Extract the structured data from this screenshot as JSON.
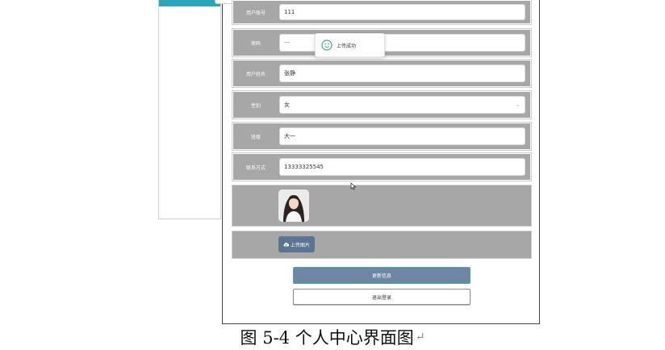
{
  "form": {
    "fields": [
      {
        "label": "用户账号",
        "value": "111"
      },
      {
        "label": "密码",
        "value": "···"
      },
      {
        "label": "用户姓名",
        "value": "张静"
      },
      {
        "label": "性别",
        "value": "女"
      },
      {
        "label": "班级",
        "value": "大一"
      },
      {
        "label": "联系方式",
        "value": "13333325545"
      }
    ],
    "upload_label": "上传图片",
    "update_label": "更新信息",
    "logout_label": "退出登录"
  },
  "toast": {
    "message": "上传成功"
  },
  "caption": {
    "text": "图 5-4 个人中心界面图",
    "return_mark": "↵"
  },
  "colors": {
    "row_bg": "#a7a7a7",
    "update_btn": "#6d86a4",
    "upload_btn": "#5b7490",
    "accent_teal": "#2aa6b7"
  },
  "icons": [
    "smile-icon",
    "cloud-upload-icon",
    "chevron-down-icon",
    "mouse-cursor-icon"
  ]
}
